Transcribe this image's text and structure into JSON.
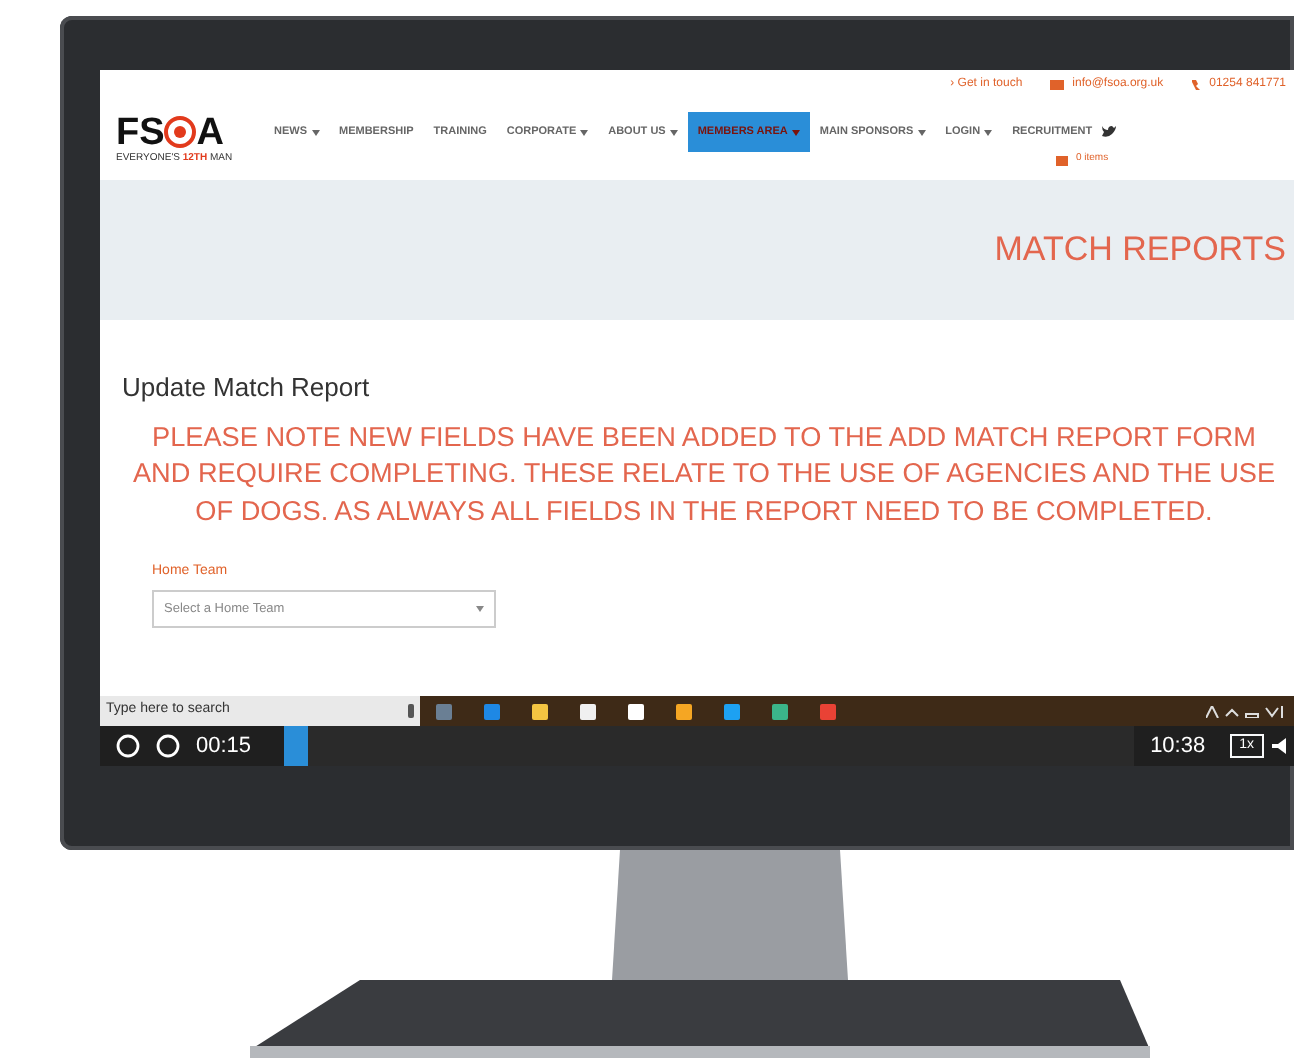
{
  "website": {
    "topbar": {
      "get_in_touch": "› Get in touch",
      "email": "info@fsoa.org.uk",
      "phone": "01254 841771"
    },
    "logo": {
      "letters_left": "FS",
      "letters_right": "A",
      "tagline_start": "EVERYONE'S",
      "tagline_highlight": "12TH",
      "tagline_end": "MAN"
    },
    "nav": [
      {
        "label": "NEWS",
        "dropdown": true,
        "selected": false
      },
      {
        "label": "MEMBERSHIP",
        "dropdown": false,
        "selected": false
      },
      {
        "label": "TRAINING",
        "dropdown": false,
        "selected": false
      },
      {
        "label": "CORPORATE",
        "dropdown": true,
        "selected": false
      },
      {
        "label": "ABOUT US",
        "dropdown": true,
        "selected": false
      },
      {
        "label": "MEMBERS AREA",
        "dropdown": true,
        "selected": true
      },
      {
        "label": "MAIN SPONSORS",
        "dropdown": true,
        "selected": false
      },
      {
        "label": "LOGIN",
        "dropdown": true,
        "selected": false
      },
      {
        "label": "RECRUITMENT",
        "dropdown": false,
        "selected": false
      }
    ],
    "cart": "0 items",
    "banner_title": "MATCH REPORTS",
    "heading": "Update Match Report",
    "notice": "PLEASE NOTE NEW FIELDS HAVE BEEN ADDED TO THE ADD MATCH REPORT FORM AND REQUIRE COMPLETING. THESE RELATE TO THE USE OF AGENCIES AND THE USE OF DOGS. AS ALWAYS ALL FIELDS IN THE REPORT NEED TO BE COMPLETED.",
    "form": {
      "label": "Home Team",
      "placeholder": "Select a Home Team"
    }
  },
  "taskbar": {
    "search_placeholder": "Type here to search"
  },
  "player": {
    "elapsed": "00:15",
    "level": 0.03,
    "duration": "10:38",
    "speed": "1x"
  }
}
